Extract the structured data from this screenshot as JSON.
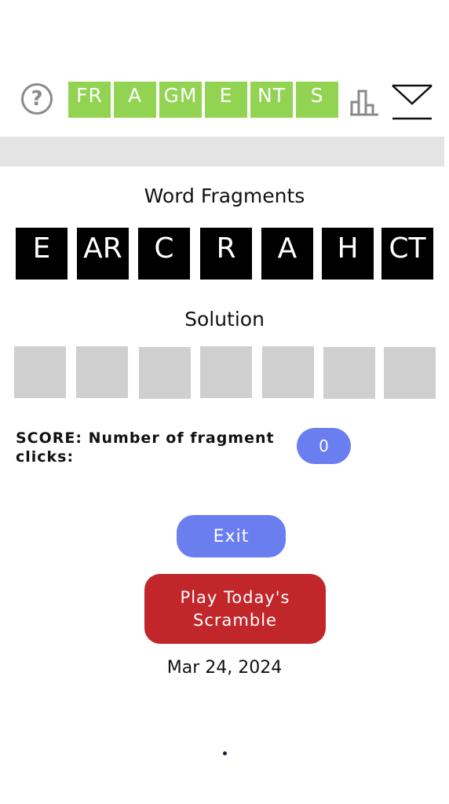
{
  "header": {
    "help_icon_glyph": "?",
    "logo_tiles": [
      "FR",
      "A",
      "GM",
      "E",
      "NT",
      "S"
    ],
    "logo_color": "#93d352"
  },
  "fragments_section": {
    "title": "Word Fragments",
    "tiles": [
      "E",
      "AR",
      "C",
      "R",
      "A",
      "H",
      "CT"
    ]
  },
  "solution_section": {
    "title": "Solution",
    "slot_count": 7
  },
  "score": {
    "label": "SCORE: Number of fragment clicks:",
    "value": "0"
  },
  "buttons": {
    "exit_label": "Exit",
    "play_label": "Play Today's\nScramble"
  },
  "date": "Mar 24, 2024",
  "colors": {
    "accent_blue": "#6b7ef0",
    "play_red": "#c1272a",
    "tile_black": "#000000",
    "slot_gray": "#cfcfcf",
    "bar_gray": "#e4e4e4"
  },
  "icons": {
    "help": "question-circle-icon",
    "stats": "bar-chart-icon",
    "mail": "envelope-icon"
  }
}
